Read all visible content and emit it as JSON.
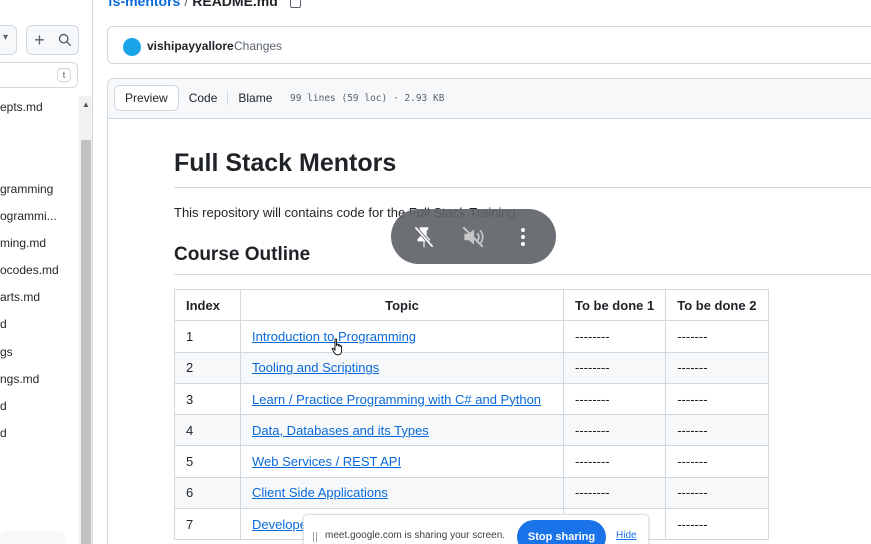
{
  "breadcrumb": {
    "repo": "fs-mentors",
    "separator": "/",
    "file": "README.md"
  },
  "sidebar": {
    "goto_shortcut": "t",
    "items": [
      {
        "label": "epts.md"
      },
      {
        "label": "gramming"
      },
      {
        "label": "ogrammi..."
      },
      {
        "label": "ming.md"
      },
      {
        "label": "ocodes.md"
      },
      {
        "label": "arts.md"
      },
      {
        "label": "d"
      },
      {
        "label": "gs"
      },
      {
        "label": "ngs.md"
      },
      {
        "label": "d"
      },
      {
        "label": "d"
      }
    ]
  },
  "commit": {
    "user": "vishipayyallore",
    "message": "Changes",
    "avatar_color": "#1aa3e8"
  },
  "file_header": {
    "tabs": [
      "Preview",
      "Code",
      "Blame"
    ],
    "active_tab": "Preview",
    "meta": "99 lines (59 loc) · 2.93 KB"
  },
  "readme": {
    "title": "Full Stack Mentors",
    "intro": "This repository will contains code for the Full Stack Training",
    "section_title": "Course Outline",
    "table": {
      "headers": [
        "Index",
        "Topic",
        "To be done 1",
        "To be done 2"
      ],
      "rows": [
        {
          "index": "1",
          "topic": "Introduction to Programming",
          "d1": "--------",
          "d2": "-------"
        },
        {
          "index": "2",
          "topic": "Tooling and Scriptings",
          "d1": "--------",
          "d2": "-------"
        },
        {
          "index": "3",
          "topic": "Learn / Practice Programming with C# and Python",
          "d1": "--------",
          "d2": "-------"
        },
        {
          "index": "4",
          "topic": "Data, Databases and its Types",
          "d1": "--------",
          "d2": "-------"
        },
        {
          "index": "5",
          "topic": "Web Services / REST API",
          "d1": "--------",
          "d2": "-------"
        },
        {
          "index": "6",
          "topic": "Client Side Applications",
          "d1": "--------",
          "d2": "-------"
        },
        {
          "index": "7",
          "topic": "Develope",
          "d1": "",
          "d2": "-------"
        }
      ]
    }
  },
  "meet_controls": {
    "icons": [
      "unpin-icon",
      "mute-icon",
      "more-options-icon"
    ]
  },
  "share_bar": {
    "text": "meet.google.com is sharing your screen.",
    "stop_label": "Stop sharing",
    "hide_label": "Hide"
  },
  "colors": {
    "link": "#0969da",
    "border": "#d1d9e0",
    "meet_blue": "#1a73e8"
  }
}
